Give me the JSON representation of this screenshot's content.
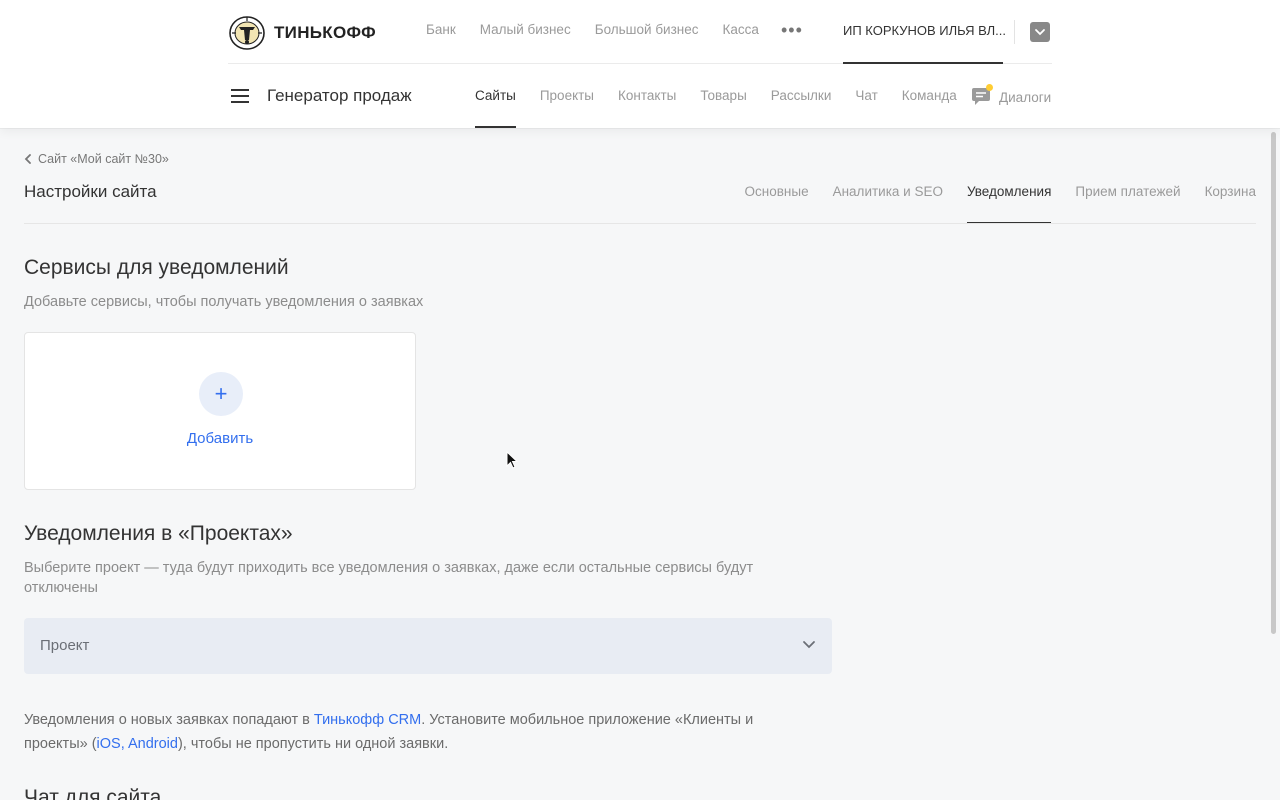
{
  "header": {
    "logo_text": "ТИНЬКОФФ",
    "top_nav": [
      "Банк",
      "Малый бизнес",
      "Большой бизнес",
      "Касса"
    ],
    "account_name": "ИП КОРКУНОВ ИЛЬЯ ВЛ...",
    "product_title": "Генератор продаж",
    "sub_nav": [
      {
        "label": "Сайты",
        "active": true
      },
      {
        "label": "Проекты",
        "active": false
      },
      {
        "label": "Контакты",
        "active": false
      },
      {
        "label": "Товары",
        "active": false
      },
      {
        "label": "Рассылки",
        "active": false
      },
      {
        "label": "Чат",
        "active": false
      },
      {
        "label": "Команда",
        "active": false
      }
    ],
    "dialogs_label": "Диалоги"
  },
  "page": {
    "back_label": "Сайт «Мой сайт №30»",
    "title": "Настройки сайта",
    "tabs": [
      {
        "label": "Основные",
        "active": false
      },
      {
        "label": "Аналитика и SEO",
        "active": false
      },
      {
        "label": "Уведомления",
        "active": true
      },
      {
        "label": "Прием платежей",
        "active": false
      },
      {
        "label": "Корзина",
        "active": false
      }
    ]
  },
  "services": {
    "heading": "Сервисы для уведомлений",
    "description": "Добавьте сервисы, чтобы получать уведомления о заявках",
    "add_label": "Добавить"
  },
  "projects": {
    "heading": "Уведомления в «Проектах»",
    "description": "Выберите проект — туда будут приходить все уведомления о заявках, даже если остальные сервисы будут отключены",
    "select_placeholder": "Проект",
    "info_part1": "Уведомления о новых заявках попадают в ",
    "crm_link": "Тинькофф CRM",
    "info_part2": ". Установите мобильное приложение «Клиенты и проекты» (",
    "ios_link": "iOS",
    "sep": ", ",
    "android_link": "Android",
    "info_part3": "), чтобы не пропустить ни одной заявки."
  },
  "chat": {
    "heading": "Чат для сайта"
  },
  "colors": {
    "accent": "#336fee",
    "badge": "#ffcd33",
    "select_bg": "#e8ecf3"
  }
}
